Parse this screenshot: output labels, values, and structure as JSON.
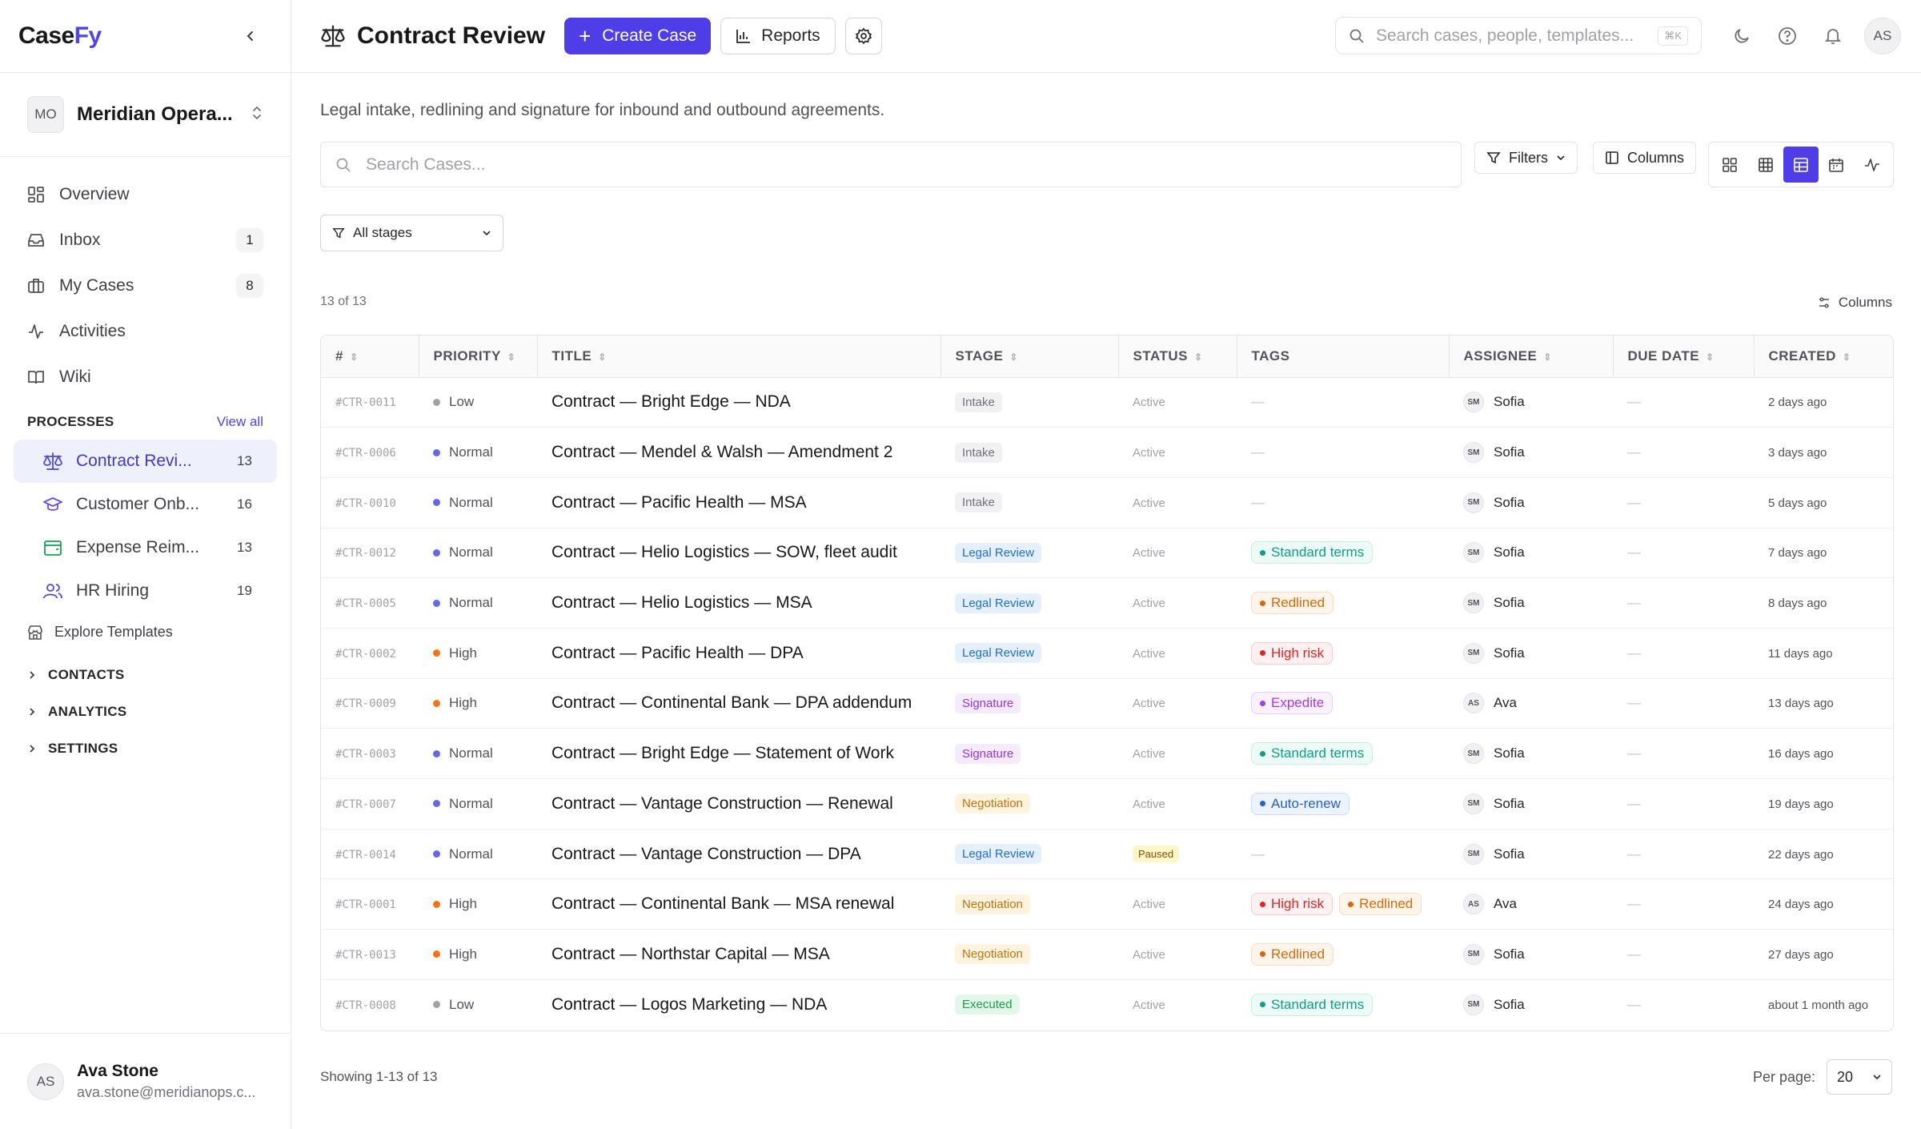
{
  "app": {
    "logo_a": "Case",
    "logo_b": "Fy"
  },
  "org": {
    "initials": "MO",
    "name": "Meridian Opera..."
  },
  "nav": [
    {
      "label": "Overview",
      "count": "",
      "icon": "grid-icon"
    },
    {
      "label": "Inbox",
      "count": "1",
      "icon": "inbox-icon"
    },
    {
      "label": "My Cases",
      "count": "8",
      "icon": "briefcase-icon"
    },
    {
      "label": "Activities",
      "count": "",
      "icon": "activity-icon"
    },
    {
      "label": "Wiki",
      "count": "",
      "icon": "book-icon"
    }
  ],
  "processes": {
    "heading": "PROCESSES",
    "view_all": "View all",
    "items": [
      {
        "label": "Contract Revi...",
        "count": "13",
        "icon": "scale-icon",
        "color": "#4f46e5"
      },
      {
        "label": "Customer Onb...",
        "count": "16",
        "icon": "graduation-cap-icon",
        "color": "#6d4fe0"
      },
      {
        "label": "Expense Reim...",
        "count": "13",
        "icon": "wallet-icon",
        "color": "#16a34a"
      },
      {
        "label": "HR Hiring",
        "count": "19",
        "icon": "users-icon",
        "color": "#4f46e5"
      }
    ]
  },
  "explore_templates": "Explore Templates",
  "groups": [
    "CONTACTS",
    "ANALYTICS",
    "SETTINGS"
  ],
  "user": {
    "initials": "AS",
    "name": "Ava Stone",
    "email": "ava.stone@meridianops.c..."
  },
  "header": {
    "title": "Contract Review",
    "create_label": "Create Case",
    "reports_label": "Reports",
    "search_placeholder": "Search cases, people, templates...",
    "search_kbd": "⌘K",
    "avatar": "AS"
  },
  "subtitle": "Legal intake, redlining and signature for inbound and outbound agreements.",
  "case_search_placeholder": "Search Cases...",
  "filters_label": "Filters",
  "columns_label": "Columns",
  "stage_filter": "All stages",
  "count_text": "13 of 13",
  "columns_link": "Columns",
  "table": {
    "headers": [
      "#",
      "PRIORITY",
      "TITLE",
      "STAGE",
      "STATUS",
      "TAGS",
      "ASSIGNEE",
      "DUE DATE",
      "CREATED"
    ],
    "rows": [
      {
        "id": "#CTR-0011",
        "priority": "Low",
        "title": "Contract — Bright Edge — NDA",
        "stage": "Intake",
        "status": "Active",
        "tags": [],
        "assignee_initials": "SM",
        "assignee": "Sofia",
        "due": "—",
        "created": "2 days ago"
      },
      {
        "id": "#CTR-0006",
        "priority": "Normal",
        "title": "Contract — Mendel & Walsh — Amendment 2",
        "stage": "Intake",
        "status": "Active",
        "tags": [],
        "assignee_initials": "SM",
        "assignee": "Sofia",
        "due": "—",
        "created": "3 days ago"
      },
      {
        "id": "#CTR-0010",
        "priority": "Normal",
        "title": "Contract — Pacific Health — MSA",
        "stage": "Intake",
        "status": "Active",
        "tags": [],
        "assignee_initials": "SM",
        "assignee": "Sofia",
        "due": "—",
        "created": "5 days ago"
      },
      {
        "id": "#CTR-0012",
        "priority": "Normal",
        "title": "Contract — Helio Logistics — SOW, fleet audit",
        "stage": "Legal Review",
        "status": "Active",
        "tags": [
          "Standard terms"
        ],
        "assignee_initials": "SM",
        "assignee": "Sofia",
        "due": "—",
        "created": "7 days ago"
      },
      {
        "id": "#CTR-0005",
        "priority": "Normal",
        "title": "Contract — Helio Logistics — MSA",
        "stage": "Legal Review",
        "status": "Active",
        "tags": [
          "Redlined"
        ],
        "assignee_initials": "SM",
        "assignee": "Sofia",
        "due": "—",
        "created": "8 days ago"
      },
      {
        "id": "#CTR-0002",
        "priority": "High",
        "title": "Contract — Pacific Health — DPA",
        "stage": "Legal Review",
        "status": "Active",
        "tags": [
          "High risk"
        ],
        "assignee_initials": "SM",
        "assignee": "Sofia",
        "due": "—",
        "created": "11 days ago"
      },
      {
        "id": "#CTR-0009",
        "priority": "High",
        "title": "Contract — Continental Bank — DPA addendum",
        "stage": "Signature",
        "status": "Active",
        "tags": [
          "Expedite"
        ],
        "assignee_initials": "AS",
        "assignee": "Ava",
        "due": "—",
        "created": "13 days ago"
      },
      {
        "id": "#CTR-0003",
        "priority": "Normal",
        "title": "Contract — Bright Edge — Statement of Work",
        "stage": "Signature",
        "status": "Active",
        "tags": [
          "Standard terms"
        ],
        "assignee_initials": "SM",
        "assignee": "Sofia",
        "due": "—",
        "created": "16 days ago"
      },
      {
        "id": "#CTR-0007",
        "priority": "Normal",
        "title": "Contract — Vantage Construction — Renewal",
        "stage": "Negotiation",
        "status": "Active",
        "tags": [
          "Auto-renew"
        ],
        "assignee_initials": "SM",
        "assignee": "Sofia",
        "due": "—",
        "created": "19 days ago"
      },
      {
        "id": "#CTR-0014",
        "priority": "Normal",
        "title": "Contract — Vantage Construction — DPA",
        "stage": "Legal Review",
        "status": "Paused",
        "tags": [],
        "assignee_initials": "SM",
        "assignee": "Sofia",
        "due": "—",
        "created": "22 days ago"
      },
      {
        "id": "#CTR-0001",
        "priority": "High",
        "title": "Contract — Continental Bank — MSA renewal",
        "stage": "Negotiation",
        "status": "Active",
        "tags": [
          "High risk",
          "Redlined"
        ],
        "assignee_initials": "AS",
        "assignee": "Ava",
        "due": "—",
        "created": "24 days ago"
      },
      {
        "id": "#CTR-0013",
        "priority": "High",
        "title": "Contract — Northstar Capital — MSA",
        "stage": "Negotiation",
        "status": "Active",
        "tags": [
          "Redlined"
        ],
        "assignee_initials": "SM",
        "assignee": "Sofia",
        "due": "—",
        "created": "27 days ago"
      },
      {
        "id": "#CTR-0008",
        "priority": "Low",
        "title": "Contract — Logos Marketing — NDA",
        "stage": "Executed",
        "status": "Active",
        "tags": [
          "Standard terms"
        ],
        "assignee_initials": "SM",
        "assignee": "Sofia",
        "due": "—",
        "created": "about 1 month ago"
      }
    ]
  },
  "footer": {
    "showing": "Showing 1-13 of 13",
    "per_page_label": "Per page:",
    "per_page": "20"
  },
  "colors": {
    "accent": "#4f3ee8",
    "priority_low": "#a1a1aa",
    "priority_normal": "#6366f1",
    "priority_high": "#f97316"
  }
}
